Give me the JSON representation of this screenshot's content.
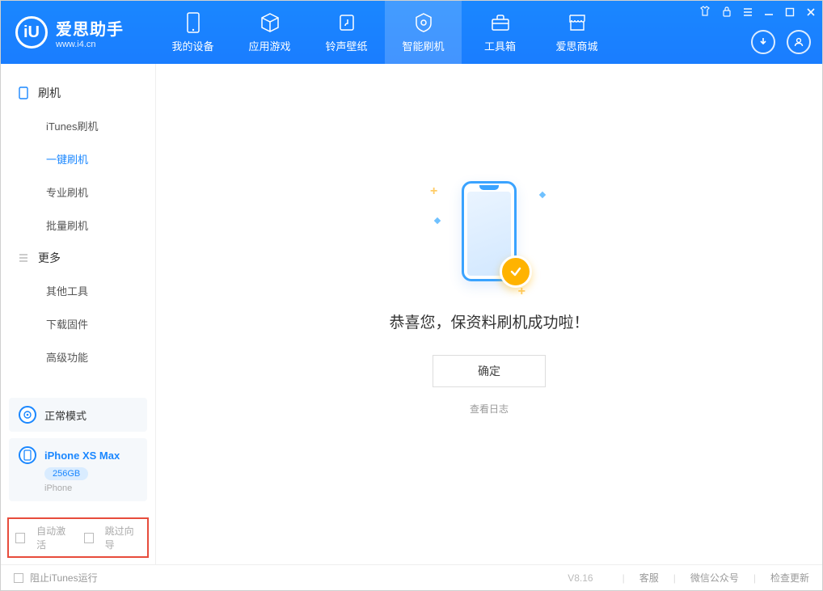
{
  "app": {
    "name": "爱思助手",
    "website": "www.i4.cn"
  },
  "nav": [
    {
      "label": "我的设备",
      "icon": "device-icon"
    },
    {
      "label": "应用游戏",
      "icon": "cube-icon"
    },
    {
      "label": "铃声壁纸",
      "icon": "ringtone-icon"
    },
    {
      "label": "智能刷机",
      "icon": "flash-icon",
      "active": true
    },
    {
      "label": "工具箱",
      "icon": "toolbox-icon"
    },
    {
      "label": "爱思商城",
      "icon": "store-icon"
    }
  ],
  "sidebar": {
    "group1": {
      "title": "刷机",
      "items": [
        "iTunes刷机",
        "一键刷机",
        "专业刷机",
        "批量刷机"
      ],
      "active_index": 1
    },
    "group2": {
      "title": "更多",
      "items": [
        "其他工具",
        "下载固件",
        "高级功能"
      ]
    },
    "mode_card": "正常模式",
    "device": {
      "name": "iPhone XS Max",
      "storage": "256GB",
      "type": "iPhone"
    },
    "checkboxes": {
      "auto_activate": "自动激活",
      "skip_guide": "跳过向导"
    }
  },
  "main": {
    "success_text": "恭喜您，保资料刷机成功啦！",
    "ok_button": "确定",
    "view_log": "查看日志"
  },
  "statusbar": {
    "block_itunes": "阻止iTunes运行",
    "version": "V8.16",
    "links": [
      "客服",
      "微信公众号",
      "检查更新"
    ]
  }
}
